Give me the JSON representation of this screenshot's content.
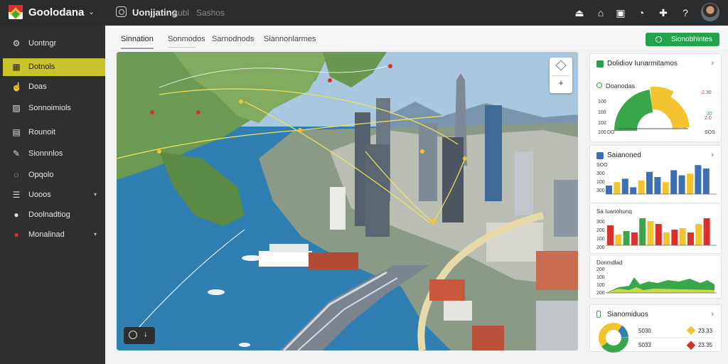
{
  "app": {
    "title": "Goolodana",
    "header_title": "Uonjjating",
    "header_sub1": "Aubl",
    "header_sub2": "Sashos"
  },
  "sidebar": {
    "items": [
      {
        "label": "Uontngr",
        "icon": "gear-icon"
      },
      {
        "label": "Dotnols",
        "icon": "grid-icon",
        "active": true
      },
      {
        "label": "Doas",
        "icon": "thumbs-up-icon"
      },
      {
        "label": "Sonnoimiols",
        "icon": "image-icon"
      },
      {
        "label": "Rounoit",
        "icon": "table-icon"
      },
      {
        "label": "Sionnnlos",
        "icon": "pencil-icon"
      },
      {
        "label": "Opqolo",
        "icon": "chat-icon"
      },
      {
        "label": "Uooos",
        "icon": "list-icon",
        "caret": true
      },
      {
        "label": "Doolnadtiog",
        "icon": "circle-icon"
      },
      {
        "label": "Monalinad",
        "icon": "red-circle-icon",
        "caret": true
      }
    ]
  },
  "tabs": [
    "Sinnation",
    "Sonmodos",
    "Sarnodnods",
    "Siannonlarmes"
  ],
  "action_button": {
    "label": "Sionobhintes"
  },
  "cards": {
    "overview": {
      "title": "Dolidiov Iunarmitamos",
      "subtitle": "Doanodas",
      "y_ticks": [
        "100",
        "100",
        "100",
        "100"
      ],
      "x_ticks": [
        "DO",
        "SOS"
      ],
      "right_values": [
        "2.30",
        "30",
        "2.0"
      ]
    },
    "bars": {
      "title": "Saianoned",
      "y_ticks": [
        "SOO",
        "300",
        "100",
        "300"
      ],
      "values": [
        10,
        14,
        18,
        8,
        16,
        26,
        20,
        14,
        28,
        22,
        24,
        34,
        30
      ]
    },
    "colored_bars": {
      "title": "Sa Iuanohunq",
      "y_ticks": [
        "300",
        "200",
        "100",
        "200"
      ],
      "values": [
        28,
        15,
        20,
        18,
        38,
        34,
        30,
        18,
        22,
        24,
        18,
        30,
        38
      ]
    },
    "area": {
      "title": "Donmdlad",
      "y_ticks": [
        "200",
        "100",
        "100",
        "200"
      ]
    },
    "donut": {
      "title": "Sianomiduos",
      "rows": [
        {
          "label": "5030",
          "value": "23.33"
        },
        {
          "label": "5033",
          "value": "23.35"
        }
      ]
    }
  },
  "colors": {
    "accent": "#c8c22b",
    "brand_green": "#22a34a",
    "sidebar": "#2e2f31"
  }
}
